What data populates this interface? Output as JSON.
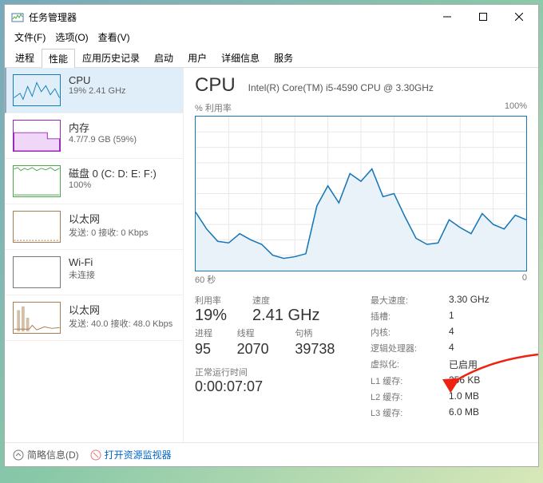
{
  "window": {
    "title": "任务管理器"
  },
  "menubar": [
    "文件(F)",
    "选项(O)",
    "查看(V)"
  ],
  "tabs": [
    "进程",
    "性能",
    "应用历史记录",
    "启动",
    "用户",
    "详细信息",
    "服务"
  ],
  "active_tab": 1,
  "sidebar": {
    "items": [
      {
        "title": "CPU",
        "sub": "19% 2.41 GHz",
        "color": "c-cpu",
        "active": true
      },
      {
        "title": "内存",
        "sub": "4.7/7.9 GB (59%)",
        "color": "c-mem"
      },
      {
        "title": "磁盘 0 (C: D: E: F:)",
        "sub": "100%",
        "color": "c-disk"
      },
      {
        "title": "以太网",
        "sub": "发送: 0 接收: 0 Kbps",
        "color": "c-eth"
      },
      {
        "title": "Wi-Fi",
        "sub": "未连接",
        "color": "c-wifi"
      },
      {
        "title": "以太网",
        "sub": "发送: 40.0 接收: 48.0 Kbps",
        "color": "c-eth"
      }
    ]
  },
  "main": {
    "title": "CPU",
    "subtitle": "Intel(R) Core(TM) i5-4590 CPU @ 3.30GHz",
    "chart_top_left": "% 利用率",
    "chart_top_right": "100%",
    "chart_bottom_left": "60 秒",
    "chart_bottom_right": "0",
    "stats_primary": {
      "labels": [
        "利用率",
        "速度"
      ],
      "values": [
        "19%",
        "2.41 GHz"
      ]
    },
    "stats_secondary": {
      "labels": [
        "进程",
        "线程",
        "句柄"
      ],
      "values": [
        "95",
        "2070",
        "39738"
      ]
    },
    "uptime_label": "正常运行时间",
    "uptime_value": "0:00:07:07",
    "info": [
      {
        "k": "最大速度:",
        "v": "3.30 GHz"
      },
      {
        "k": "插槽:",
        "v": "1"
      },
      {
        "k": "内核:",
        "v": "4"
      },
      {
        "k": "逻辑处理器:",
        "v": "4"
      },
      {
        "k": "虚拟化:",
        "v": "已启用"
      },
      {
        "k": "L1 缓存:",
        "v": "256 KB"
      },
      {
        "k": "L2 缓存:",
        "v": "1.0 MB"
      },
      {
        "k": "L3 缓存:",
        "v": "6.0 MB"
      }
    ]
  },
  "footer": {
    "fewer": "简略信息(D)",
    "resmon": "打开资源监视器"
  },
  "chart_data": {
    "type": "line",
    "title": "% 利用率",
    "xlabel": "60 秒",
    "ylabel": "",
    "ylim": [
      0,
      100
    ],
    "x_seconds_ago": [
      60,
      58,
      56,
      54,
      52,
      50,
      48,
      46,
      44,
      42,
      40,
      38,
      36,
      34,
      32,
      30,
      28,
      26,
      24,
      22,
      20,
      18,
      16,
      14,
      12,
      10,
      8,
      6,
      4,
      2,
      0
    ],
    "values": [
      38,
      27,
      19,
      18,
      24,
      20,
      17,
      10,
      8,
      9,
      11,
      42,
      55,
      44,
      63,
      58,
      66,
      48,
      50,
      35,
      21,
      17,
      18,
      33,
      28,
      24,
      37,
      30,
      27,
      36,
      33
    ]
  }
}
